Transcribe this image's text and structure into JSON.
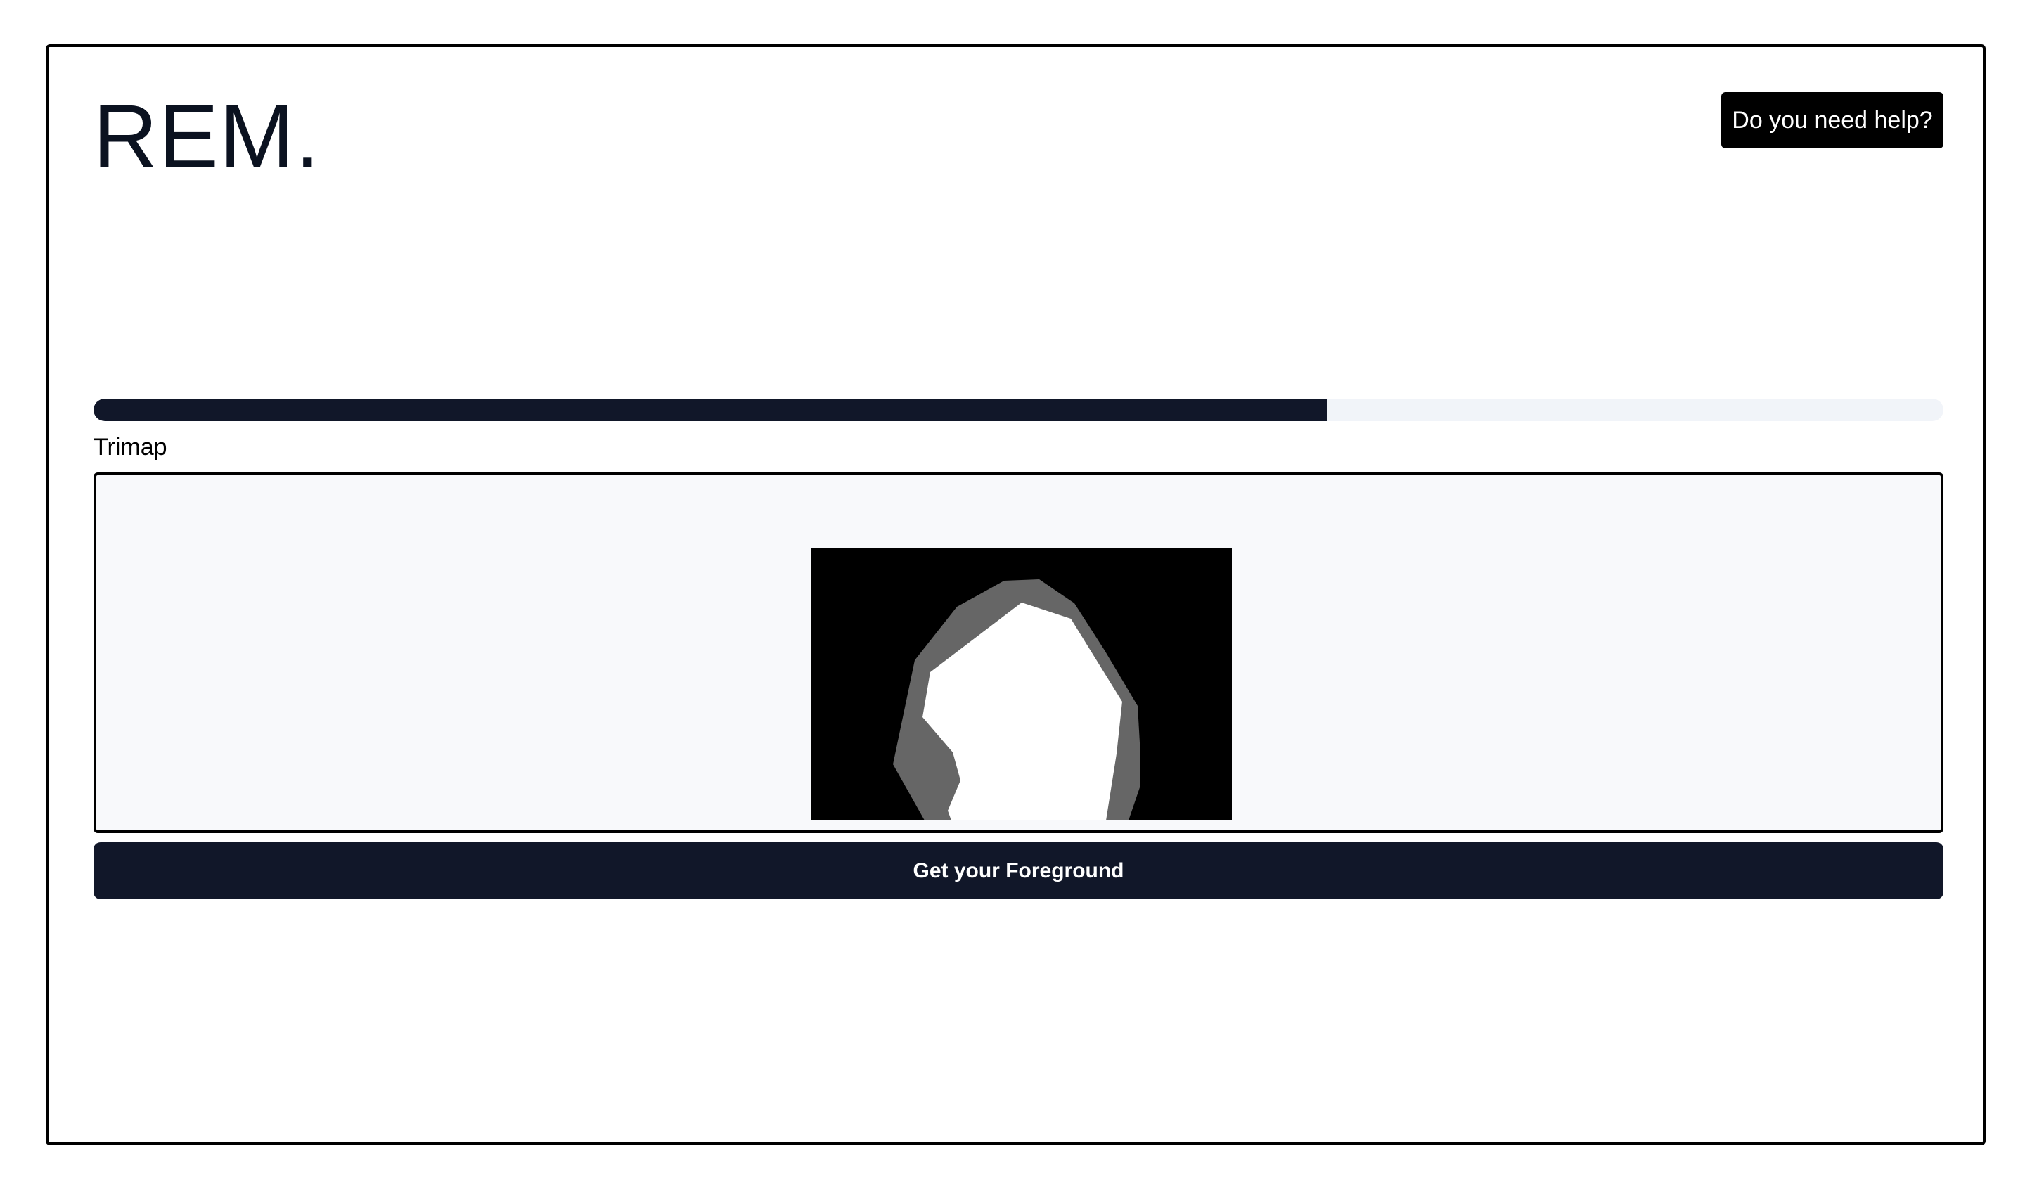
{
  "brand": {
    "logo_text": "REM."
  },
  "header": {
    "help_button_label": "Do you need help?"
  },
  "progress": {
    "value_percent": 66.7,
    "color": "#111729",
    "track_color": "#f1f4f9"
  },
  "step": {
    "label": "Trimap"
  },
  "preview": {
    "image_type": "trimap",
    "colors": {
      "background": "#000000",
      "unknown": "#666666",
      "foreground": "#ffffff"
    }
  },
  "actions": {
    "primary_label": "Get your Foreground"
  }
}
